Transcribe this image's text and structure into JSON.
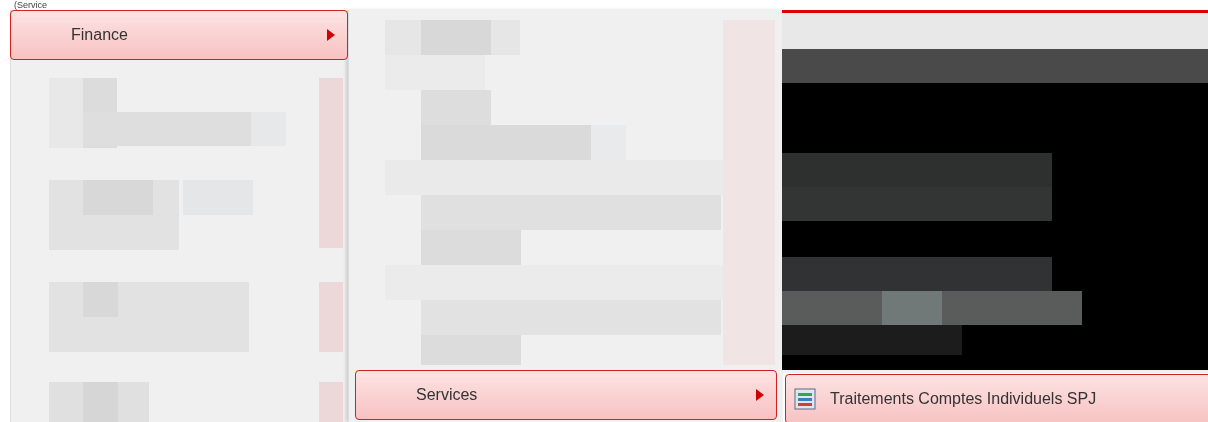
{
  "header_fragment": "(Service",
  "menus": [
    {
      "items": [
        {
          "label": "Finance",
          "selected": true,
          "has_submenu": true,
          "kind": "folder"
        }
      ]
    },
    {
      "items": [
        {
          "label": "Services",
          "selected": true,
          "has_submenu": true,
          "kind": "folder"
        }
      ]
    },
    {
      "items": [
        {
          "label": "Traitements Comptes Individuels SPJ",
          "selected": true,
          "has_submenu": false,
          "kind": "program"
        }
      ]
    }
  ]
}
